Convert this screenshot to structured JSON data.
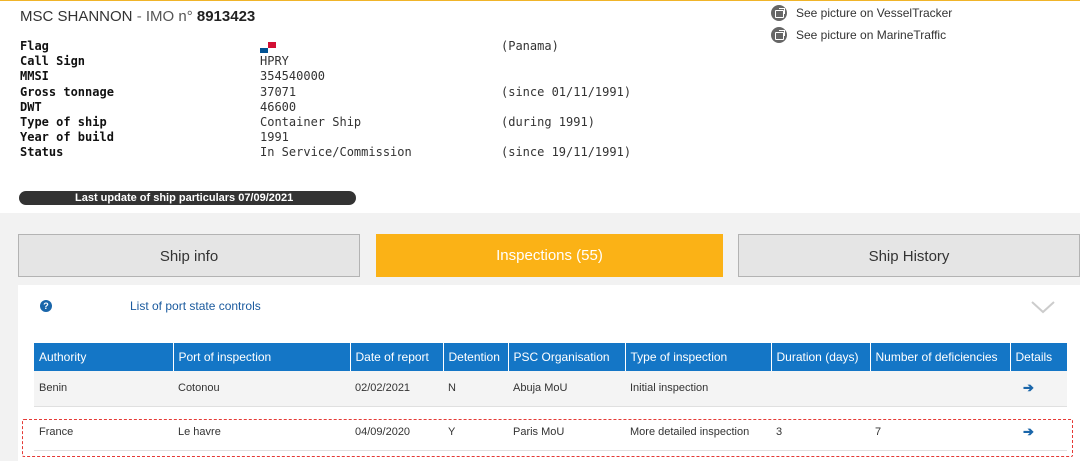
{
  "ship": {
    "name": "MSC SHANNON",
    "separator": "-",
    "imo_label": "IMO n°",
    "imo": "8913423"
  },
  "particulars": [
    {
      "label": "Flag",
      "value": "",
      "extra": "(Panama)",
      "flag": "panama"
    },
    {
      "label": "Call Sign",
      "value": "HPRY",
      "extra": ""
    },
    {
      "label": "MMSI",
      "value": "354540000",
      "extra": ""
    },
    {
      "label": "Gross tonnage",
      "value": "37071",
      "extra": "(since 01/11/1991)"
    },
    {
      "label": "DWT",
      "value": "46600",
      "extra": ""
    },
    {
      "label": "Type of ship",
      "value": "Container Ship",
      "extra": "(during 1991)"
    },
    {
      "label": "Year of build",
      "value": "1991",
      "extra": ""
    },
    {
      "label": "Status",
      "value": "In Service/Commission",
      "extra": "(since 19/11/1991)"
    }
  ],
  "links": {
    "vesseltracker": "See picture on VesselTracker",
    "marinetraffic": "See picture on MarineTraffic"
  },
  "last_update": "Last update of ship particulars 07/09/2021",
  "tabs": {
    "ship_info": "Ship info",
    "inspections": "Inspections (55)",
    "ship_history": "Ship History"
  },
  "list_title": "List of port state controls",
  "table": {
    "headers": [
      "Authority",
      "Port of inspection",
      "Date of report",
      "Detention",
      "PSC Organisation",
      "Type of inspection",
      "Duration (days)",
      "Number of deficiencies",
      "Details"
    ],
    "rows": [
      [
        "Benin",
        "Cotonou",
        "02/02/2021",
        "N",
        "Abuja MoU",
        "Initial inspection",
        "",
        "",
        ""
      ],
      [
        "France",
        "Le havre",
        "04/09/2020",
        "Y",
        "Paris MoU",
        "More detailed inspection",
        "3",
        "7",
        ""
      ]
    ]
  },
  "colors": {
    "accent": "#fbb216",
    "header_blue": "#1476c6",
    "highlight": "#e53935"
  }
}
